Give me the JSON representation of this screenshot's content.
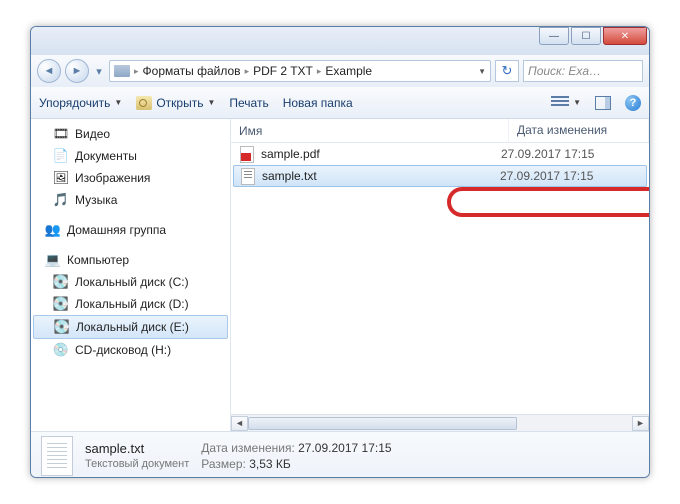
{
  "titlebar": {
    "min": "—",
    "max": "☐",
    "close": "✕"
  },
  "breadcrumb": {
    "seg1": "Форматы файлов",
    "seg2": "PDF 2 TXT",
    "seg3": "Example"
  },
  "search": {
    "placeholder": "Поиск: Exa…"
  },
  "toolbar": {
    "organize": "Упорядочить",
    "open": "Открыть",
    "print": "Печать",
    "new_folder": "Новая папка"
  },
  "sidebar": {
    "video": "Видео",
    "documents": "Документы",
    "pictures": "Изображения",
    "music": "Музыка",
    "homegroup": "Домашняя группа",
    "computer": "Компьютер",
    "disk_c": "Локальный диск (C:)",
    "disk_d": "Локальный диск (D:)",
    "disk_e": "Локальный диск (E:)",
    "cd_drive": "CD-дисковод (H:)"
  },
  "list": {
    "col_name": "Имя",
    "col_date": "Дата изменения",
    "rows": [
      {
        "name": "sample.pdf",
        "date": "27.09.2017 17:15"
      },
      {
        "name": "sample.txt",
        "date": "27.09.2017 17:15"
      }
    ]
  },
  "details": {
    "name": "sample.txt",
    "type": "Текстовый документ",
    "date_lbl": "Дата изменения:",
    "date_val": "27.09.2017 17:15",
    "size_lbl": "Размер:",
    "size_val": "3,53 КБ"
  }
}
